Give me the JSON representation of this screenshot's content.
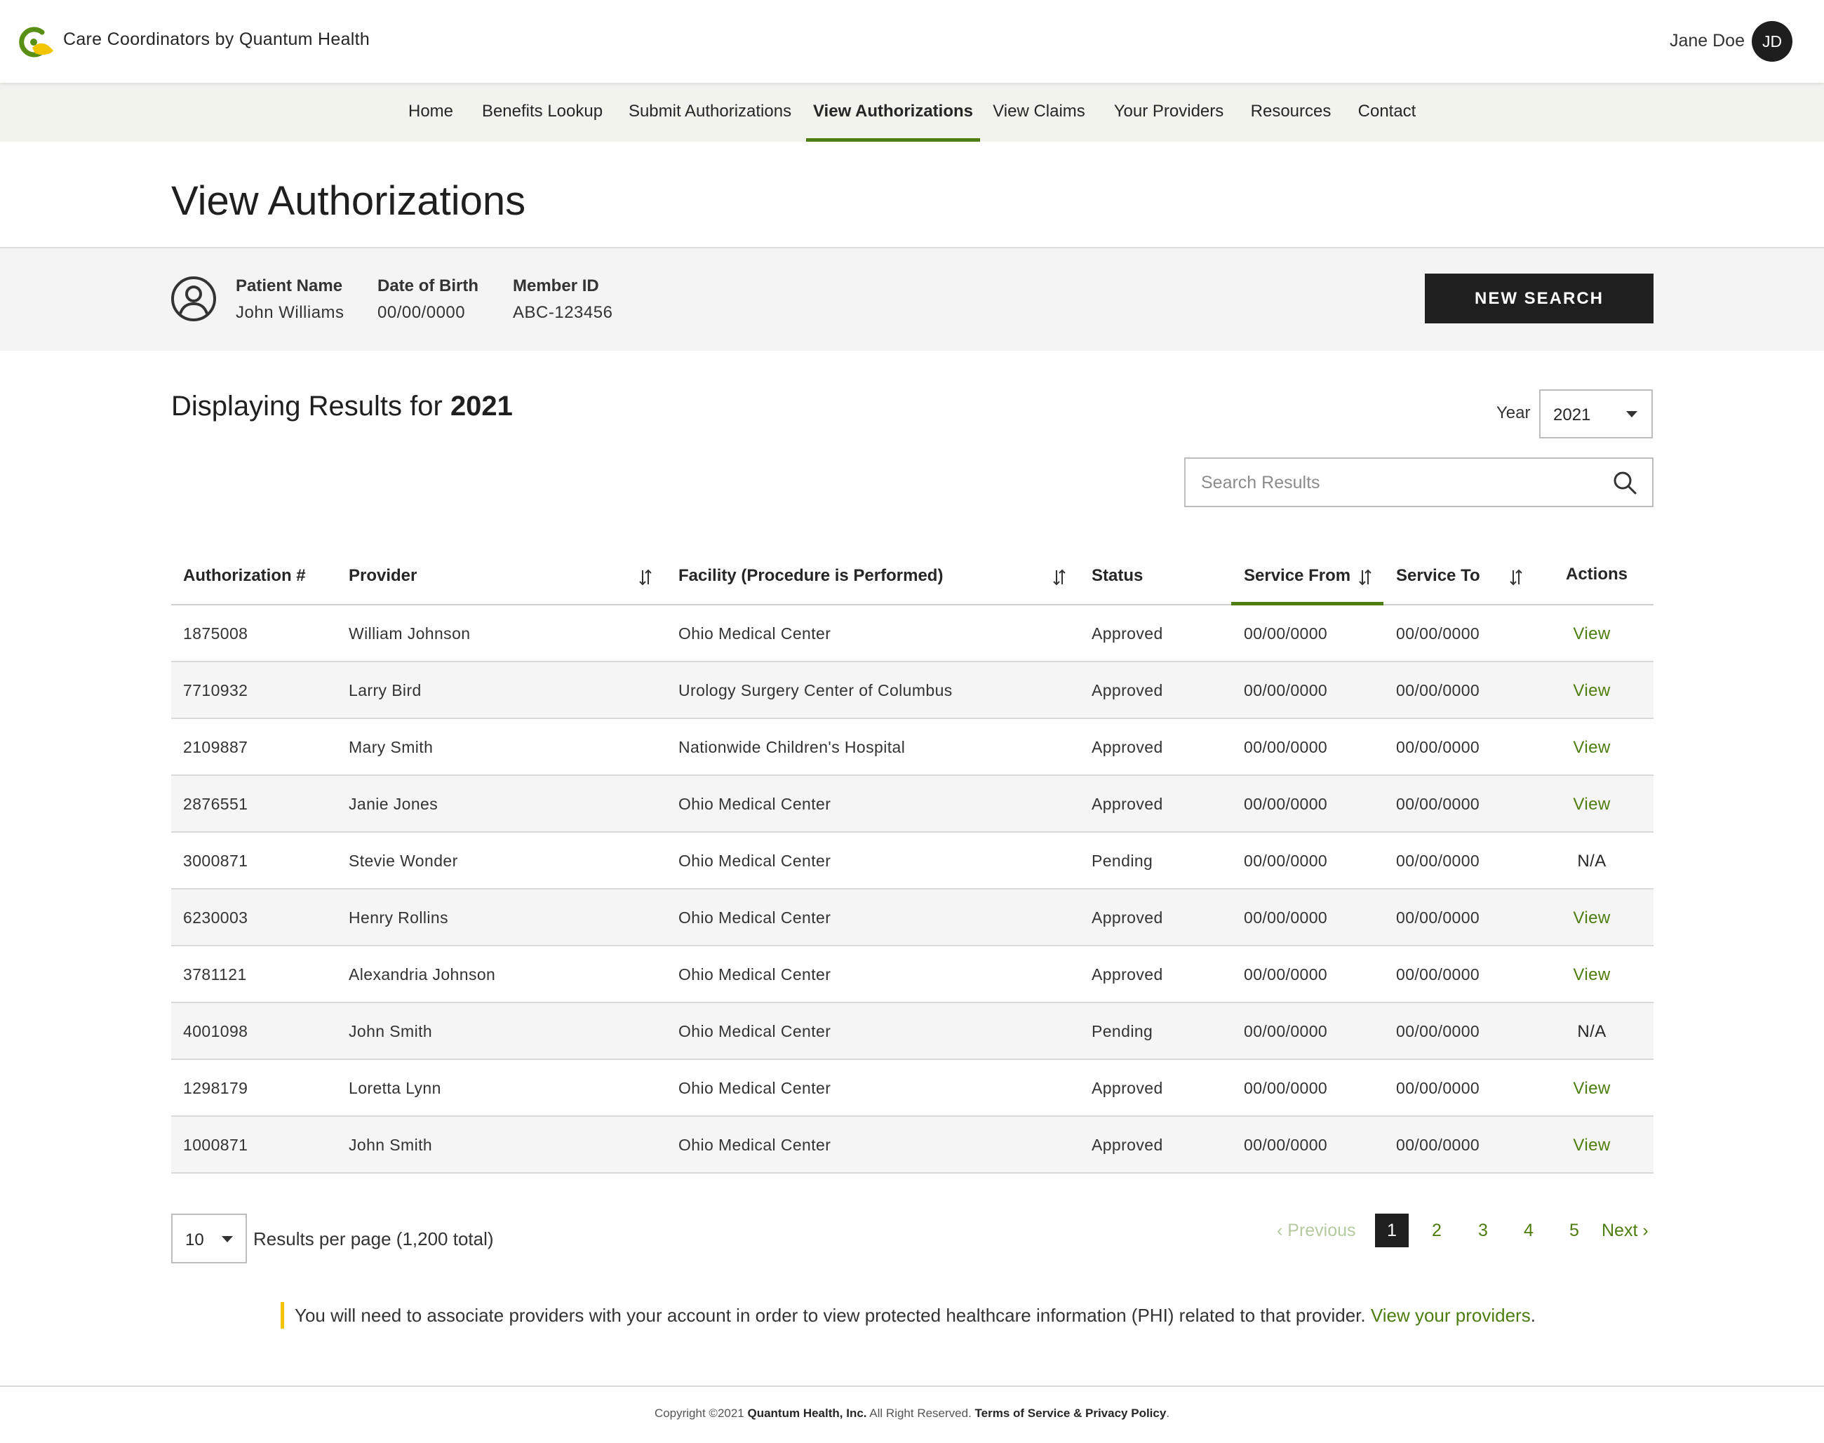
{
  "header": {
    "brand": "Care Coordinators by Quantum Health",
    "user_name": "Jane Doe",
    "user_initials": "JD",
    "brand_colors": {
      "green": "#4e7d0f",
      "yellow": "#f2c500"
    }
  },
  "nav": {
    "items": [
      {
        "label": "Home"
      },
      {
        "label": "Benefits Lookup"
      },
      {
        "label": "Submit Authorizations"
      },
      {
        "label": "View Authorizations",
        "active": true
      },
      {
        "label": "View Claims"
      },
      {
        "label": "Your Providers"
      },
      {
        "label": "Resources"
      },
      {
        "label": "Contact"
      }
    ]
  },
  "page": {
    "title": "View Authorizations"
  },
  "patient": {
    "icon": "user-circle-icon",
    "name_label": "Patient Name",
    "name": "John Williams",
    "dob_label": "Date of Birth",
    "dob": "00/00/0000",
    "member_label": "Member ID",
    "member_id": "ABC-123456",
    "new_search_label": "NEW SEARCH"
  },
  "results": {
    "heading_prefix": "Displaying Results for ",
    "heading_year": "2021",
    "year_label": "Year",
    "year_value": "2021",
    "search_placeholder": "Search Results"
  },
  "table": {
    "headers": {
      "auth": "Authorization #",
      "provider": "Provider",
      "facility": "Facility (Procedure is Performed)",
      "status": "Status",
      "service_from": "Service From",
      "service_to": "Service To",
      "actions": "Actions"
    },
    "active_sort": "service_from",
    "rows": [
      {
        "auth": "1875008",
        "provider": "William Johnson",
        "facility": "Ohio Medical Center",
        "status": "Approved",
        "from": "00/00/0000",
        "to": "00/00/0000",
        "action": "View"
      },
      {
        "auth": "7710932",
        "provider": "Larry Bird",
        "facility": "Urology Surgery Center of Columbus",
        "status": "Approved",
        "from": "00/00/0000",
        "to": "00/00/0000",
        "action": "View"
      },
      {
        "auth": "2109887",
        "provider": "Mary Smith",
        "facility": "Nationwide Children's Hospital",
        "status": "Approved",
        "from": "00/00/0000",
        "to": "00/00/0000",
        "action": "View"
      },
      {
        "auth": "2876551",
        "provider": "Janie Jones",
        "facility": "Ohio Medical Center",
        "status": "Approved",
        "from": "00/00/0000",
        "to": "00/00/0000",
        "action": "View"
      },
      {
        "auth": "3000871",
        "provider": "Stevie Wonder",
        "facility": "Ohio Medical Center",
        "status": "Pending",
        "from": "00/00/0000",
        "to": "00/00/0000",
        "action": "N/A"
      },
      {
        "auth": "6230003",
        "provider": "Henry Rollins",
        "facility": "Ohio Medical Center",
        "status": "Approved",
        "from": "00/00/0000",
        "to": "00/00/0000",
        "action": "View"
      },
      {
        "auth": "3781121",
        "provider": "Alexandria Johnson",
        "facility": "Ohio Medical Center",
        "status": "Approved",
        "from": "00/00/0000",
        "to": "00/00/0000",
        "action": "View"
      },
      {
        "auth": "4001098",
        "provider": "John Smith",
        "facility": "Ohio Medical Center",
        "status": "Pending",
        "from": "00/00/0000",
        "to": "00/00/0000",
        "action": "N/A"
      },
      {
        "auth": "1298179",
        "provider": "Loretta Lynn",
        "facility": "Ohio Medical Center",
        "status": "Approved",
        "from": "00/00/0000",
        "to": "00/00/0000",
        "action": "View"
      },
      {
        "auth": "1000871",
        "provider": "John Smith",
        "facility": "Ohio Medical Center",
        "status": "Approved",
        "from": "00/00/0000",
        "to": "00/00/0000",
        "action": "View"
      }
    ]
  },
  "pagination": {
    "per_page": "10",
    "per_page_label": "Results per page (1,200 total)",
    "previous_label": "Previous",
    "next_label": "Next",
    "pages": [
      "1",
      "2",
      "3",
      "4",
      "5"
    ],
    "current_page": "1"
  },
  "notice": {
    "text": "You will need to associate providers with your account in order to view protected healthcare information (PHI) related to that provider. ",
    "link": "View your providers",
    "suffix": "."
  },
  "footer": {
    "copyright": "Copyright ©2021 ",
    "company": "Quantum Health, Inc.",
    "rights": " All Right Reserved. ",
    "terms": "Terms of Service & Privacy Policy",
    "suffix": "."
  }
}
